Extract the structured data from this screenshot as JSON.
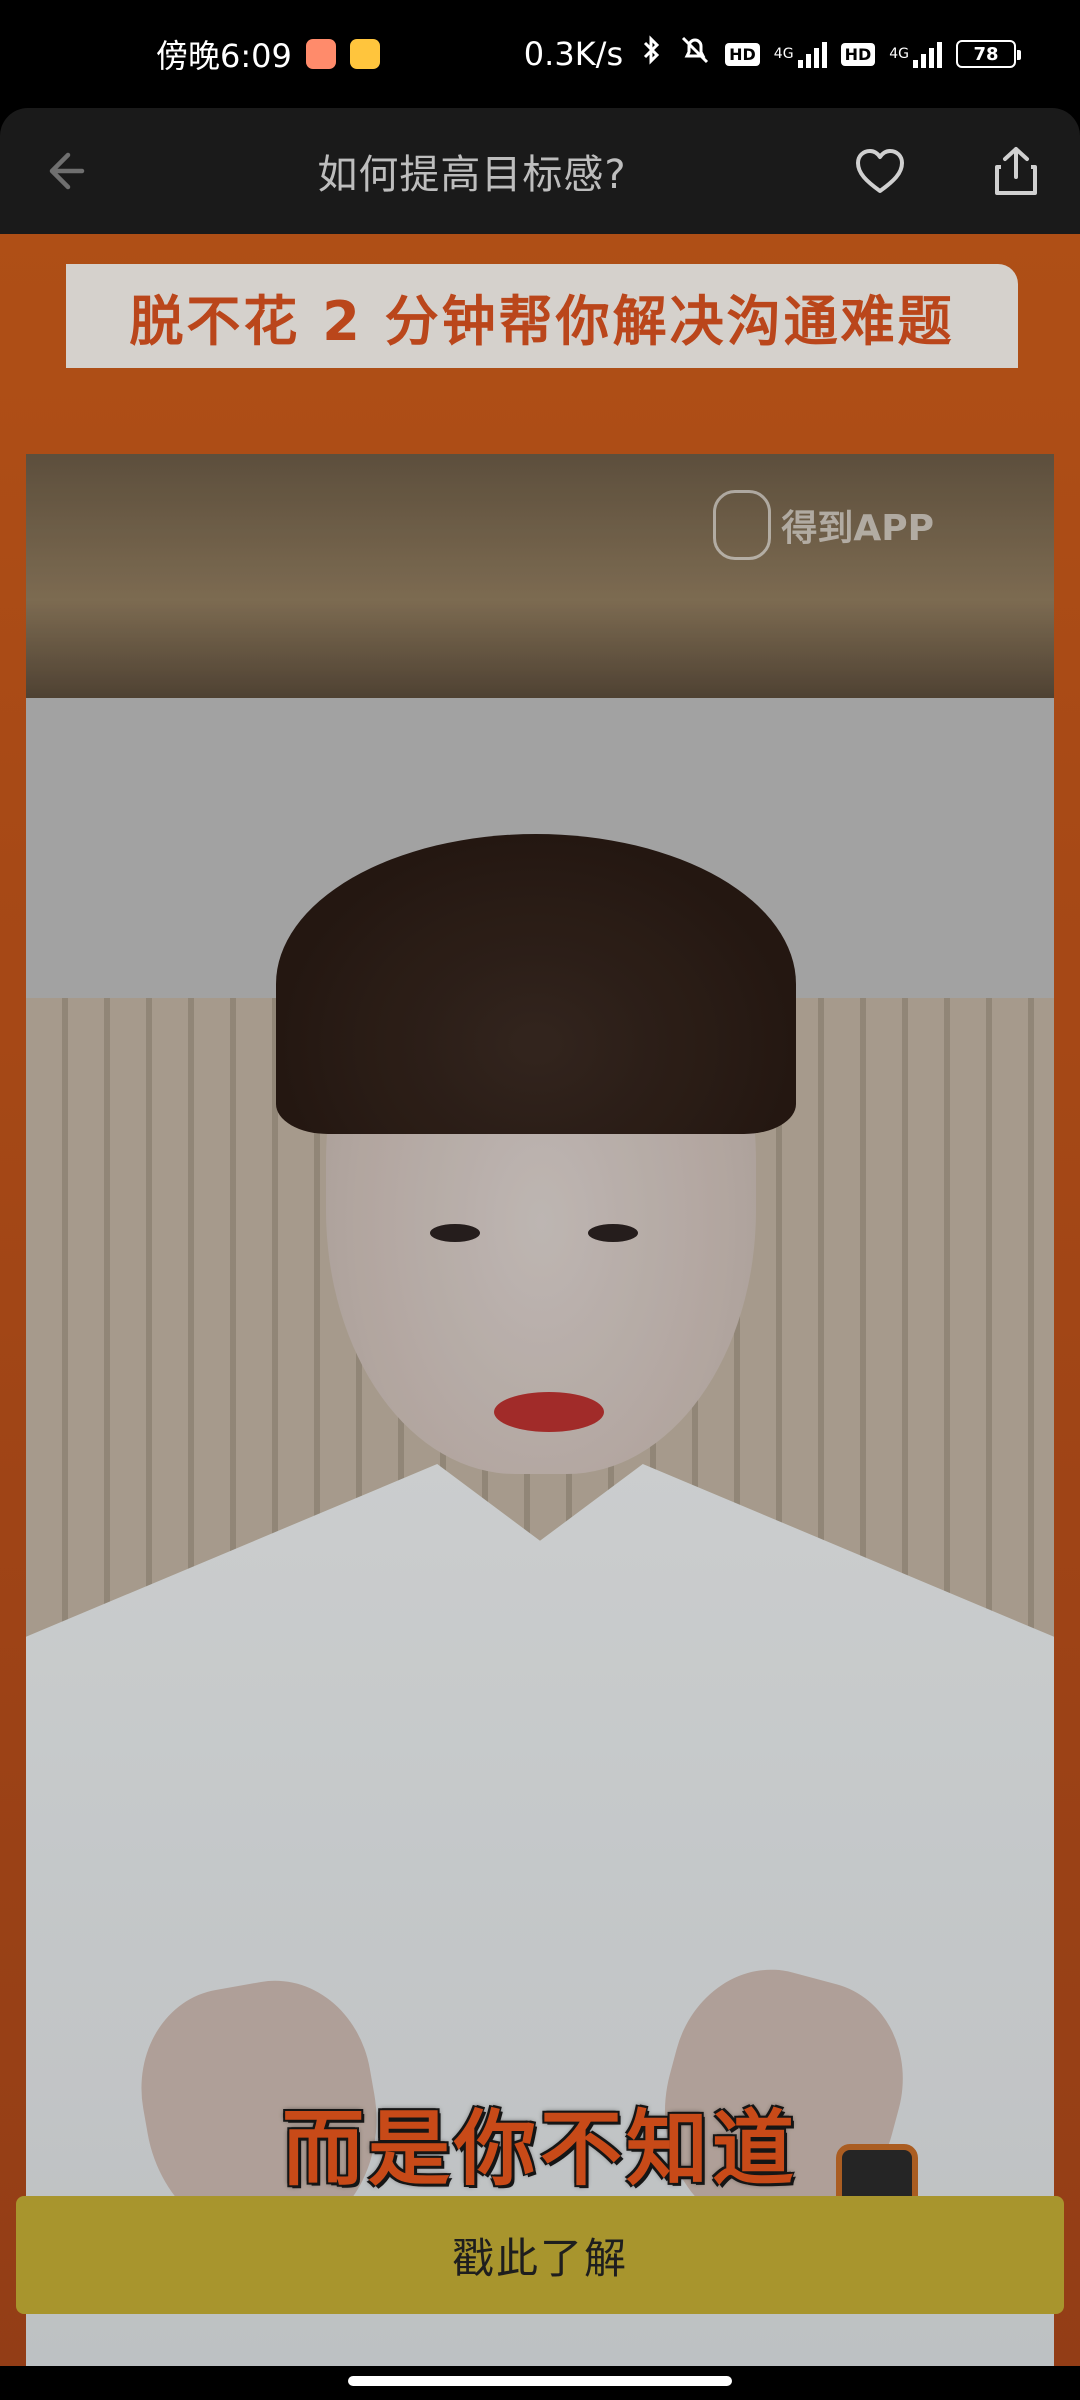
{
  "status_bar": {
    "time": "傍晚6:09",
    "network_speed": "0.3K/s",
    "hd_label": "HD",
    "net_type": "4G",
    "battery": "78"
  },
  "nav": {
    "title": "如何提高目标感?"
  },
  "content": {
    "banner_text": "脱不花 2 分钟帮你解决沟通难题",
    "watermark_text": "得到APP",
    "caption": "而是你不知道"
  },
  "cta": {
    "label": "戳此了解"
  },
  "colors": {
    "background": "#000000",
    "nav_bg": "#1a1a1a",
    "orange": "#c85a1a",
    "cta_bg": "#a8952d",
    "banner_text": "#d4501f"
  }
}
